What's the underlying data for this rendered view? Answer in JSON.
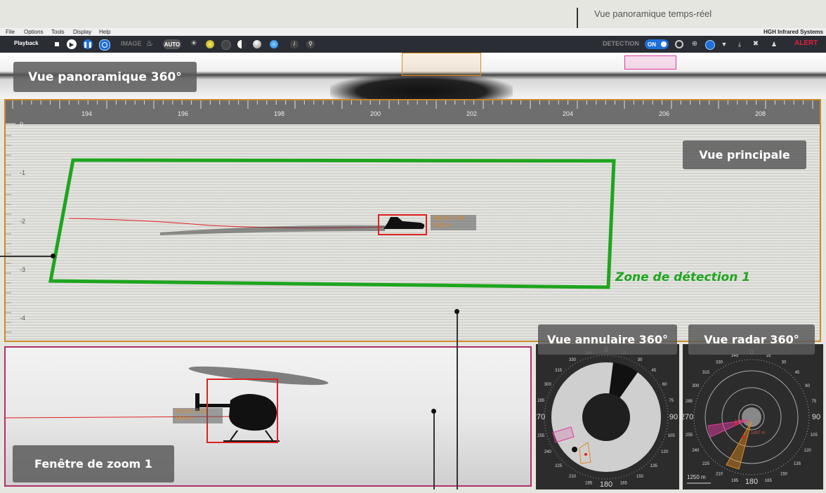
{
  "annotations": {
    "top": "Vue panoramique temps-réel"
  },
  "menu": {
    "items": [
      "File",
      "Options",
      "Tools",
      "Display",
      "Help"
    ],
    "brand": "HGH Infrared Systems"
  },
  "toolbar": {
    "playback": "Playback",
    "image_label": "IMAGE",
    "auto_label": "AUTO",
    "detection_label": "DETECTION",
    "on_label": "ON",
    "alert_label": "ALERT"
  },
  "labels": {
    "panorama": "Vue panoramique 360°",
    "main": "Vue principale",
    "zone": "Zone de détection 1",
    "annular": "Vue annulaire 360°",
    "radar": "Vue radar 360°",
    "zoom": "Fenêtre de zoom 1"
  },
  "ruler": {
    "ticks": [
      "194",
      "196",
      "198",
      "200",
      "202",
      "204",
      "206",
      "208"
    ],
    "vticks": [
      "0",
      "-1",
      "-2",
      "-3",
      "-4"
    ]
  },
  "targets": {
    "boat": {
      "line1": "199.40 -2.09",
      "line2": "1815 m"
    },
    "heli": {
      "line1": "246.10 -1.59",
      "line2": "1437 m"
    }
  },
  "annular": {
    "compass": [
      "0",
      "15",
      "30",
      "45",
      "60",
      "75",
      "90",
      "105",
      "120",
      "135",
      "150",
      "165",
      "180",
      "195",
      "210",
      "225",
      "240",
      "255",
      "270",
      "285",
      "300",
      "315",
      "330",
      "345"
    ]
  },
  "radar": {
    "compass": [
      "0",
      "15",
      "30",
      "45",
      "60",
      "75",
      "90",
      "105",
      "120",
      "135",
      "150",
      "165",
      "180",
      "195",
      "210",
      "225",
      "240",
      "255",
      "270",
      "285",
      "300",
      "315",
      "330",
      "345"
    ],
    "scale": "1250 m",
    "r1": "1815 m",
    "r2": "1437 m"
  },
  "colors": {
    "zone_green": "#1fa51f",
    "target_red": "#e02020",
    "boat_orange": "#e08a1e",
    "heli_pink": "#e03aa0",
    "toolbar_bg": "#2a2d33"
  }
}
